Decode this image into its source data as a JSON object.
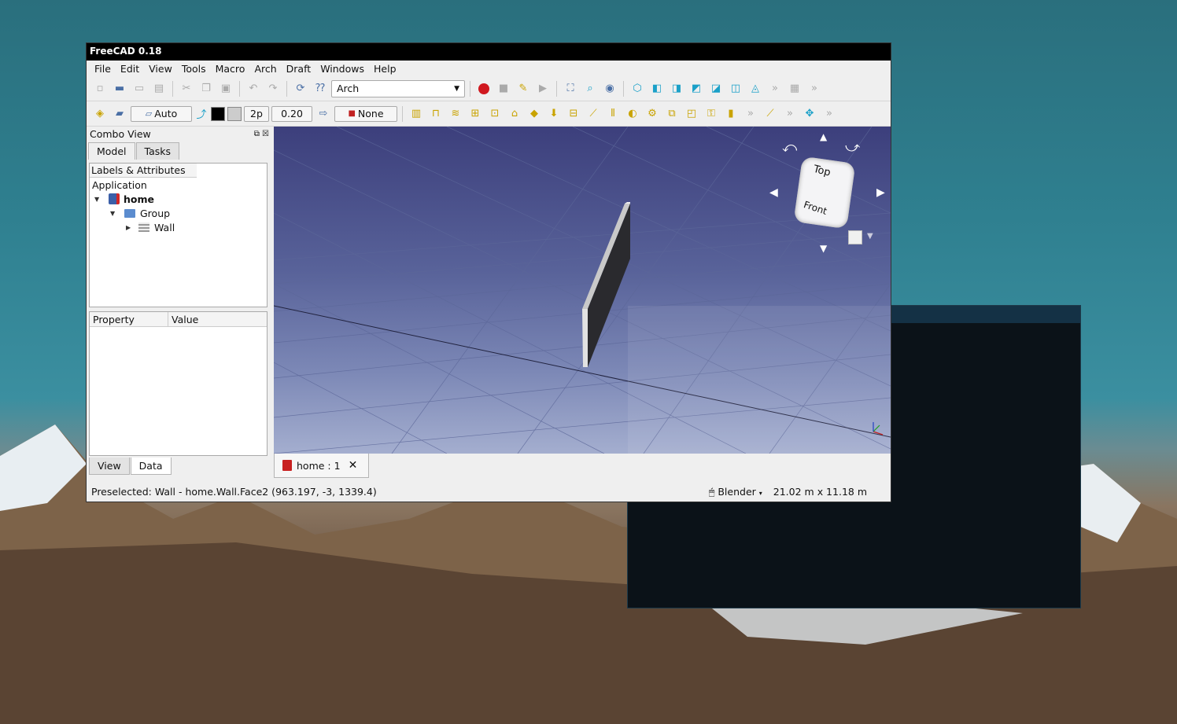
{
  "window": {
    "title": "FreeCAD 0.18"
  },
  "menu": [
    "File",
    "Edit",
    "View",
    "Tools",
    "Macro",
    "Arch",
    "Draft",
    "Windows",
    "Help"
  ],
  "toolbar1": {
    "workbench": "Arch"
  },
  "toolbar2": {
    "auto": "Auto",
    "line_width": "2p",
    "font_size": "0.20",
    "none": "None"
  },
  "combo_view": {
    "title": "Combo View",
    "tabs": [
      "Model",
      "Tasks"
    ],
    "tree_header": "Labels & Attributes",
    "tree": {
      "root": "Application",
      "doc": "home",
      "group": "Group",
      "wall": "Wall"
    },
    "prop_headers": [
      "Property",
      "Value"
    ],
    "bottom_tabs": [
      "View",
      "Data"
    ]
  },
  "navcube": {
    "top": "Top",
    "front": "Front"
  },
  "doc_tab": "home : 1",
  "status": {
    "message": "Preselected: Wall - home.Wall.Face2 (963.197, -3, 1339.4)",
    "nav_style": "Blender",
    "dimensions": "21.02 m x 11.18 m"
  },
  "colors": {
    "view_top": "#3c3f7c",
    "view_bottom": "#a4aecf",
    "record": "#d0181f"
  }
}
